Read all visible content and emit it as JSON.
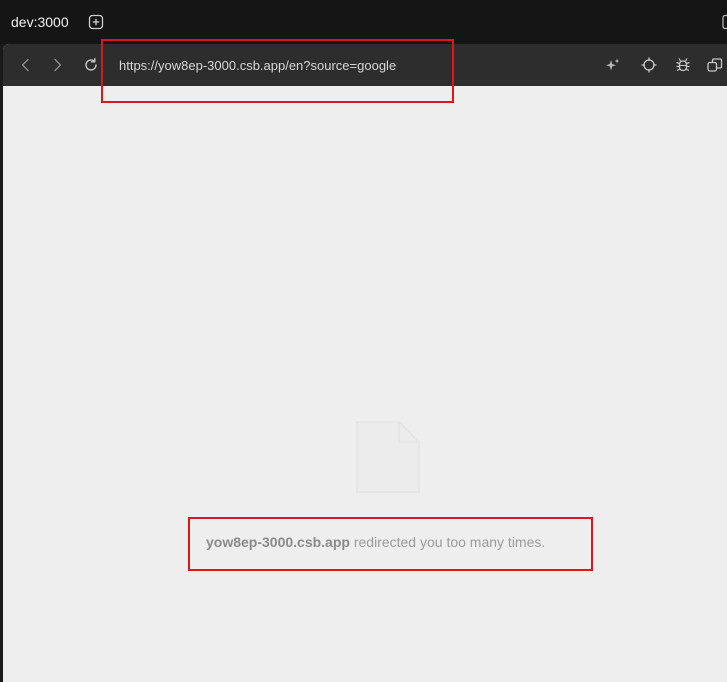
{
  "tab": {
    "title": "dev:3000"
  },
  "toolbar": {
    "url": "https://yow8ep-3000.csb.app/en?source=google"
  },
  "error": {
    "host": "yow8ep-3000.csb.app",
    "message": " redirected you too many times."
  },
  "icons": {
    "new_tab": "plus-square-icon",
    "back": "chevron-left-icon",
    "forward": "chevron-right-icon",
    "reload": "reload-icon",
    "sparkle": "sparkle-icon",
    "crosshair": "crosshair-icon",
    "bug": "bug-icon",
    "windows": "copy-windows-icon",
    "document": "document-icon"
  },
  "colors": {
    "annotation_box": "#e0141c",
    "tabbar_bg": "#151515",
    "toolbar_bg": "#2d2d2d",
    "content_bg": "#eeeeee"
  }
}
